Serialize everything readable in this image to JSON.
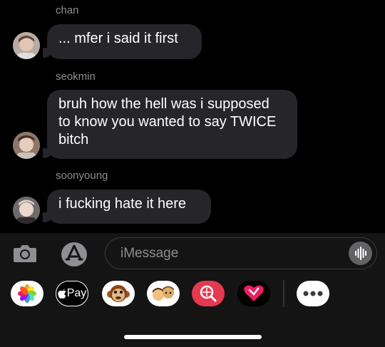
{
  "messages": [
    {
      "sender": "chan",
      "lines": [
        "... mfer i said it first"
      ]
    },
    {
      "sender": "seokmin",
      "lines": [
        "bruh how the hell was i supposed",
        "to know you wanted to say TWICE",
        "bitch"
      ]
    },
    {
      "sender": "soonyoung",
      "lines": [
        "i fucking hate it here"
      ]
    }
  ],
  "compose": {
    "placeholder": "iMessage",
    "apple_pay_label": "Pay"
  },
  "app_drawer": {
    "icons": [
      "photos-icon",
      "apple-pay-icon",
      "animoji-monkey-icon",
      "memoji-icon",
      "image-search-icon",
      "digital-touch-icon",
      "more-apps-icon"
    ]
  },
  "colors": {
    "background": "#000000",
    "bubble": "#26252a",
    "sender_name": "#8e8e93",
    "compose_bar": "#141414"
  }
}
